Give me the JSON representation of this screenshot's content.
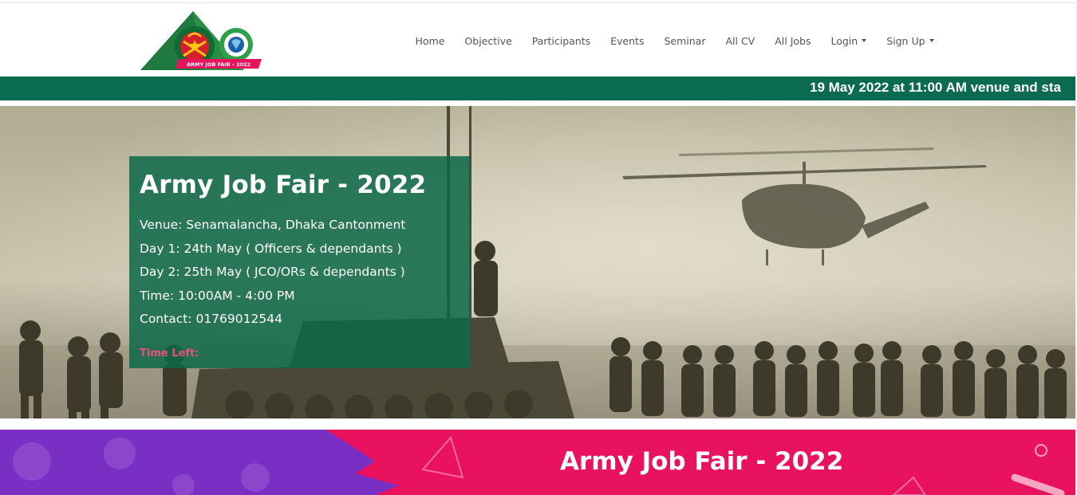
{
  "header": {
    "logo_text": "ARMY JOB FAIR - 2022",
    "nav": [
      {
        "label": "Home"
      },
      {
        "label": "Objective"
      },
      {
        "label": "Participants"
      },
      {
        "label": "Events"
      },
      {
        "label": "Seminar"
      },
      {
        "label": "All CV"
      },
      {
        "label": "All Jobs"
      },
      {
        "label": "Login",
        "dropdown": true
      },
      {
        "label": "Sign Up",
        "dropdown": true
      }
    ]
  },
  "ticker": {
    "text": "19 May 2022 at 11:00 AM venue and sta"
  },
  "hero": {
    "title": "Army Job Fair - 2022",
    "lines": [
      "Venue: Senamalancha, Dhaka Cantonment",
      "Day 1: 24th May ( Officers & dependants )",
      "Day 2: 25th May ( JCO/ORs & dependants )",
      "Time: 10:00AM - 4:00 PM",
      "Contact: 01769012544"
    ],
    "time_left_label": "Time Left:"
  },
  "banner": {
    "title": "Army Job Fair - 2022"
  },
  "colors": {
    "brand_green": "#0a6b50",
    "card_green": "#0d6948",
    "banner_pink": "#e8125f",
    "banner_purple": "#7a2fc4",
    "accent_pink": "#e8507e"
  }
}
